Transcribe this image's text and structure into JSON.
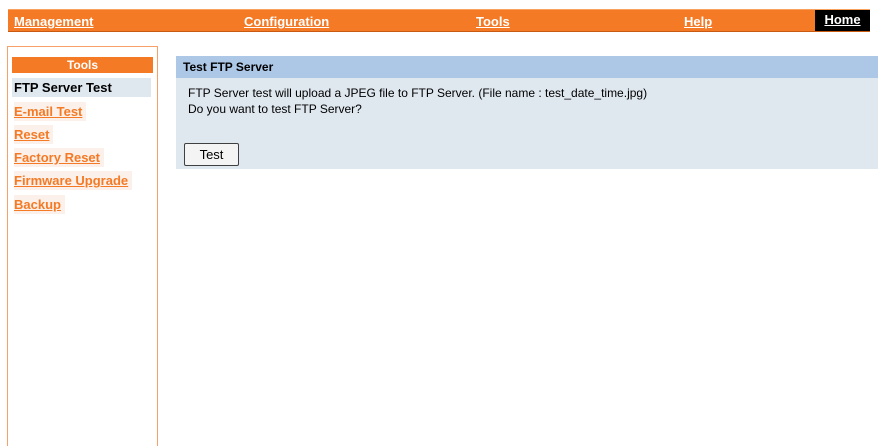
{
  "topnav": {
    "management": "Management",
    "configuration": "Configuration",
    "tools": "Tools",
    "help": "Help",
    "home": "Home"
  },
  "sidebar": {
    "title": "Tools",
    "items": [
      {
        "label": "FTP Server Test",
        "active": true
      },
      {
        "label": "E-mail Test",
        "active": false
      },
      {
        "label": "Reset",
        "active": false
      },
      {
        "label": "Factory Reset",
        "active": false
      },
      {
        "label": "Firmware Upgrade",
        "active": false
      },
      {
        "label": "Backup",
        "active": false
      }
    ]
  },
  "main": {
    "panel_title": "Test FTP Server",
    "description_line1": "FTP Server test will upload a JPEG file to FTP Server. (File name : test_date_time.jpg)",
    "description_line2": "Do you want to test FTP Server?",
    "test_button": "Test"
  },
  "colors": {
    "accent_orange": "#f47a25",
    "panel_header_blue": "#adc8e6",
    "panel_body": "#dfe7ef",
    "home_black": "#000000"
  }
}
